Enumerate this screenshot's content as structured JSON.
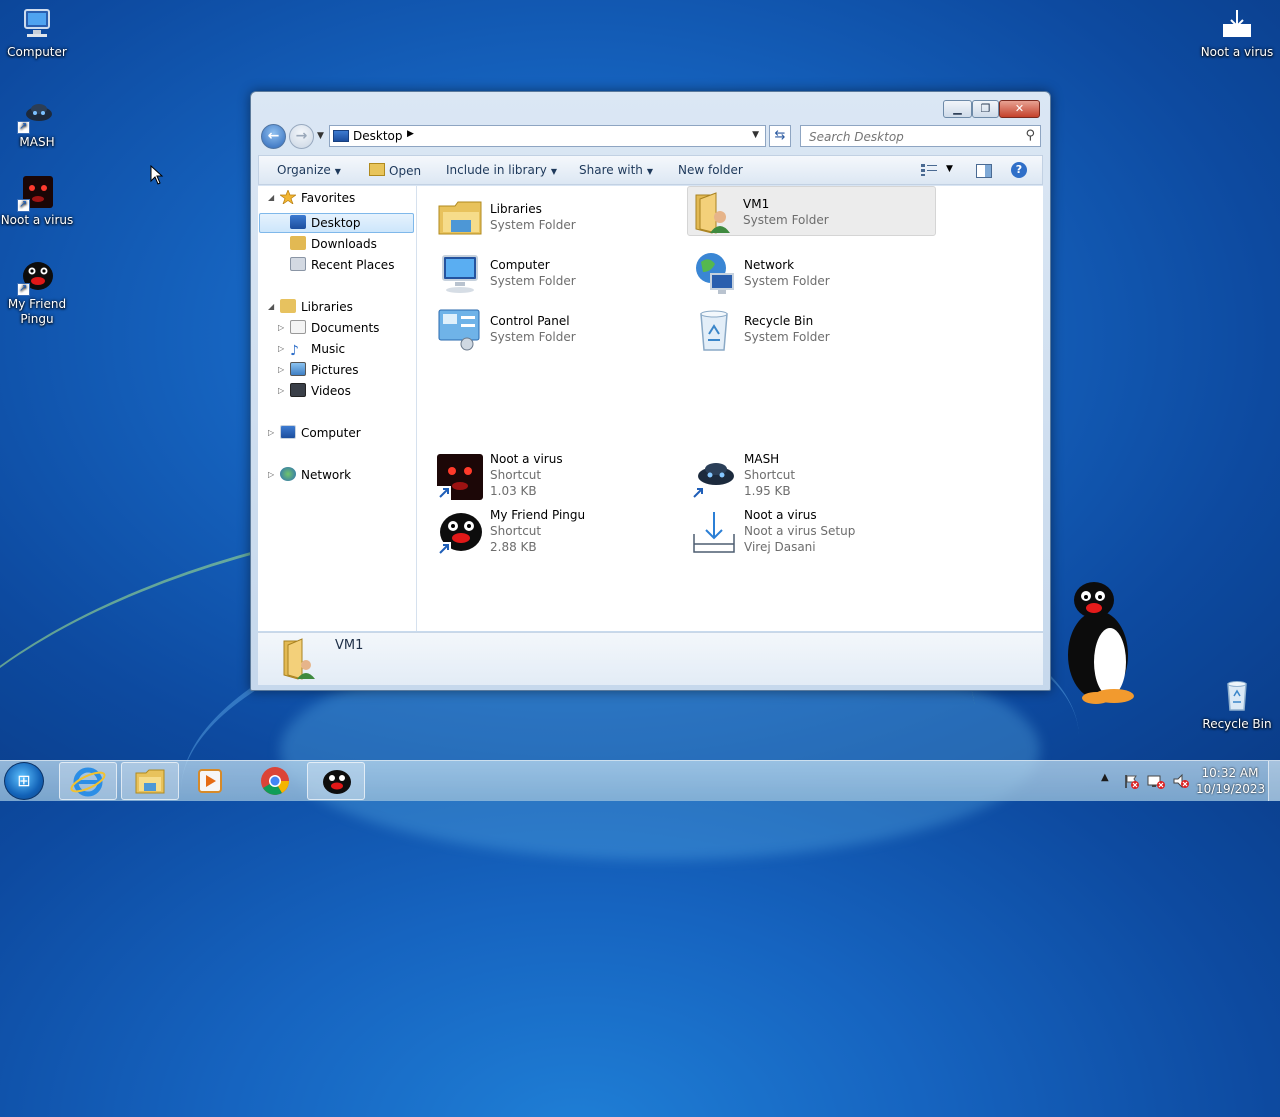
{
  "desktop": {
    "icons": [
      {
        "label": "Computer",
        "icon": "computer-icon"
      },
      {
        "label": "MASH",
        "icon": "mash-icon"
      },
      {
        "label": "Noot a virus",
        "icon": "noot-icon"
      },
      {
        "label": "My Friend Pingu",
        "icon": "pingu-icon"
      },
      {
        "label": "Noot a virus",
        "icon": "installer-icon"
      },
      {
        "label": "Recycle Bin",
        "icon": "recycle-bin-icon"
      }
    ]
  },
  "explorer": {
    "address": {
      "location": "Desktop"
    },
    "search": {
      "placeholder": "Search Desktop"
    },
    "commands": {
      "organize": "Organize",
      "open": "Open",
      "include_library": "Include in library",
      "share_with": "Share with",
      "new_folder": "New folder"
    },
    "nav": {
      "favorites": "Favorites",
      "desktop": "Desktop",
      "downloads": "Downloads",
      "recent_places": "Recent Places",
      "libraries": "Libraries",
      "documents": "Documents",
      "music": "Music",
      "pictures": "Pictures",
      "videos": "Videos",
      "computer": "Computer",
      "network": "Network"
    },
    "items": [
      {
        "name": "Libraries",
        "type": "System Folder",
        "size": ""
      },
      {
        "name": "VM1",
        "type": "System Folder",
        "size": ""
      },
      {
        "name": "Computer",
        "type": "System Folder",
        "size": ""
      },
      {
        "name": "Network",
        "type": "System Folder",
        "size": ""
      },
      {
        "name": "Control Panel",
        "type": "System Folder",
        "size": ""
      },
      {
        "name": "Recycle Bin",
        "type": "System Folder",
        "size": ""
      },
      {
        "name": "Noot a virus",
        "type": "Shortcut",
        "size": "1.03 KB"
      },
      {
        "name": "MASH",
        "type": "Shortcut",
        "size": "1.95 KB"
      },
      {
        "name": "My Friend Pingu",
        "type": "Shortcut",
        "size": "2.88 KB"
      },
      {
        "name": "Noot a virus",
        "type": "Noot a virus Setup",
        "size": "Virej Dasani"
      }
    ],
    "selected_item": "VM1",
    "details": {
      "name": "VM1"
    }
  },
  "taskbar": {
    "apps": [
      "internet-explorer-icon",
      "explorer-icon",
      "media-player-icon",
      "chrome-icon",
      "pingu-icon"
    ],
    "clock": {
      "time": "10:32 AM",
      "date": "10/19/2023"
    }
  },
  "colors": {
    "desktop_bg": "#1664c0",
    "window_chrome": "#c6d8ec",
    "selection": "#cde6fb",
    "close_button": "#c4412b"
  }
}
